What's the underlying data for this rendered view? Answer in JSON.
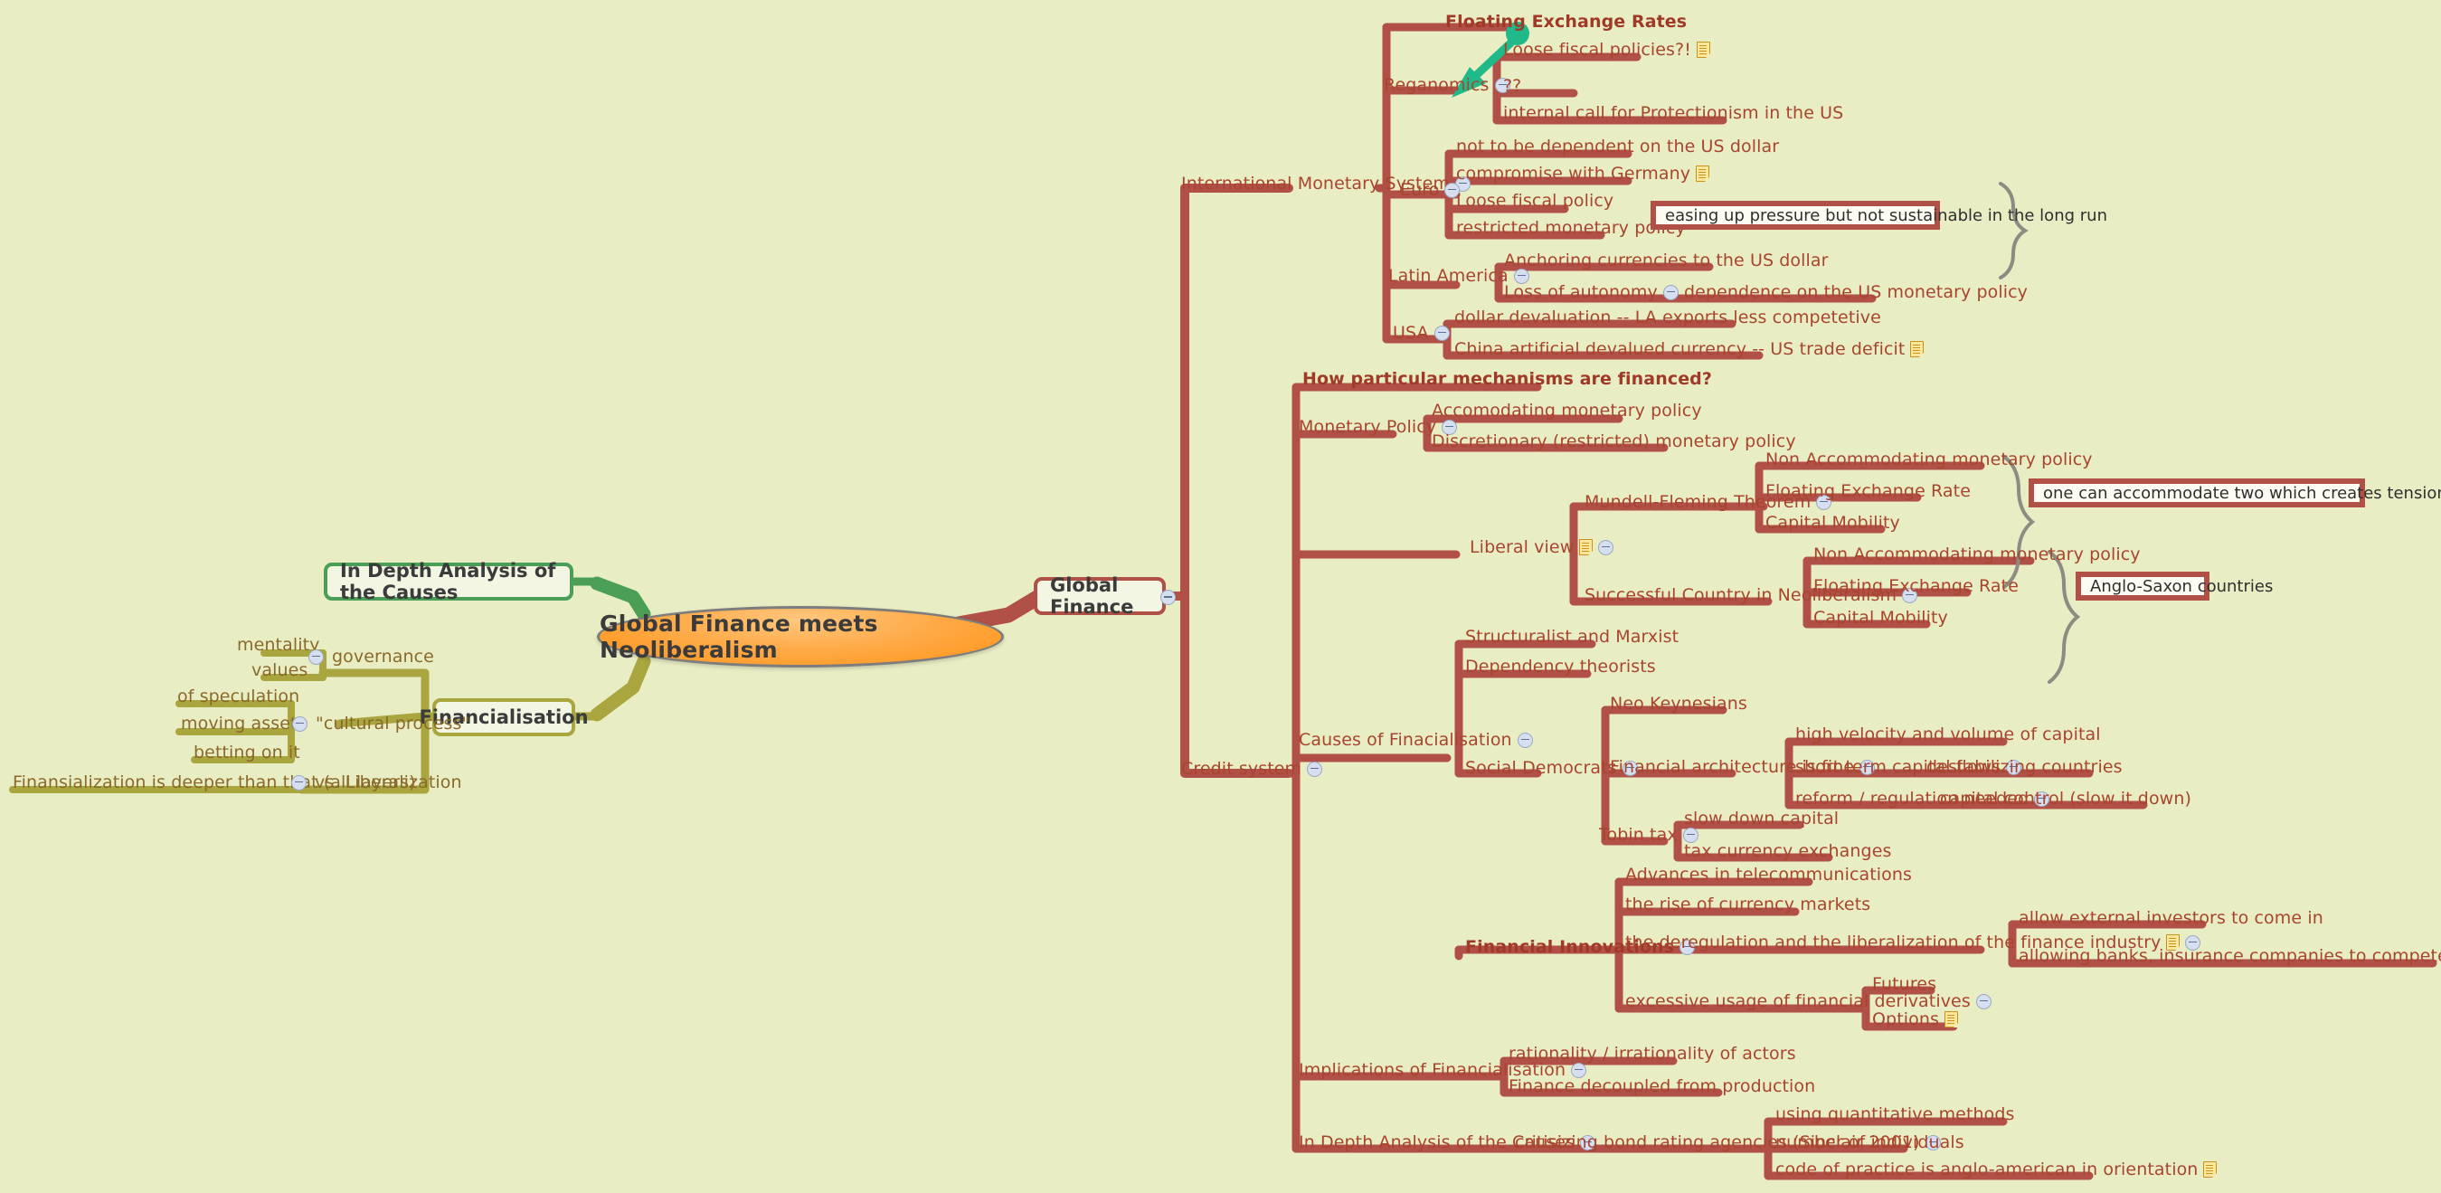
{
  "root": {
    "label": "Global Finance meets Neoliberalism"
  },
  "main_nodes": {
    "in_depth_left": "In Depth Analysis of the Causes",
    "financialisation": "Financialisation",
    "global_finance": "Global Finance"
  },
  "branches": {
    "international_monetary_system": {
      "label": "International Monetary System",
      "children": {
        "floating_exchange_rates": "Floating Exchange Rates",
        "reganomics": {
          "label": "Reganomics",
          "children": [
            "Loose fiscal policies?!",
            "??",
            "internal call for Protectionism in the US"
          ]
        },
        "euro": {
          "label": "Euro",
          "children": [
            "not to be dependent on the US dollar",
            "compromise with Germany",
            "Loose fiscal policy",
            "restricted monetary policy"
          ],
          "callout": "easing up pressure but not sustainable in the long run"
        },
        "latin_america": {
          "label": "Latin America",
          "children": [
            "Anchoring currencies to the US dollar",
            "Loss of autonomy"
          ],
          "grandchild": "dependence on the US monetary policy"
        },
        "usa": {
          "label": "USA",
          "children": [
            "dollar devaluation -- LA exports less competetive",
            "China artificial devalued currency -- US trade deficit"
          ]
        }
      }
    },
    "credit_system": {
      "label": "Credit system",
      "children": {
        "how_financed": "How particular mechanisms are financed?",
        "monetary_policy": {
          "label": "Monetary Policy",
          "children": [
            "Accomodating monetary policy",
            "Discretionary (restricted) monetary policy"
          ]
        },
        "liberal_view": {
          "label": "Liberal view",
          "mundell": {
            "label": "Mundell-Fleming Theorem",
            "children": [
              "Non Accommodating monetary policy",
              "Floating Exchange Rate",
              "Capital Mobility"
            ],
            "callout": "one can accommodate two which creates tension with the third"
          },
          "successful": {
            "label": "Successful Country in Neoliberalism",
            "children": [
              "Non Accommodating monetary policy",
              "Floating Exchange Rate",
              "Capital Mobility"
            ],
            "callout": "Anglo-Saxon countries"
          }
        },
        "causes": {
          "label": "Causes of Finacialisation",
          "children": [
            "Structuralist and Marxist",
            "Dependency theorists"
          ],
          "social_democrats": {
            "label": "Social Democrats",
            "children": {
              "neo_keynesians": "Neo Keynesians",
              "fin_architecture": {
                "label": "Financial architecture is fine",
                "children": [
                  "high velocity and volume of capital",
                  "short term capital flows",
                  "reform / regulation needed"
                ],
                "leaf_flows": "destabilizing countries",
                "leaf_reform": "capital control (slow it down)"
              },
              "tobin_tax": {
                "label": "Tobin tax",
                "children": [
                  "slow down capital",
                  "tax currency exchanges"
                ]
              }
            }
          },
          "financial_innovations": {
            "label": "Financial Innovations",
            "children": [
              "Advances in telecommunications",
              "the rise of currency markets",
              "the deregulation and the liberalization of the finance industry",
              "excessive usage of financial derivatives"
            ],
            "deregulation_children": [
              "allow external investors to come in",
              "allowing banks, insurance companies to compete in each other's sector"
            ],
            "derivatives_children": [
              "Futures",
              "Options"
            ]
          }
        },
        "implications": {
          "label": "Implications of Financialisation",
          "children": [
            "rationality / irrationality of actors",
            "Finance decoupled from production"
          ]
        },
        "in_depth": {
          "label": "In Depth Analysis of the Causes",
          "child": "critisizing bond rating agencies (Sinclair 2001)",
          "grandchildren": [
            "using quantitative methods",
            "number of individuals",
            "code of practice is anglo-american in orientation"
          ]
        }
      }
    },
    "financialisation": {
      "label": "Financialisation",
      "governance": {
        "label": "governance",
        "children": [
          "mentality",
          "values"
        ]
      },
      "cultural_process": {
        "label": "\"cultural process\"",
        "children": [
          "of speculation",
          "moving assets",
          "betting on it"
        ]
      },
      "vs_liberalization": {
        "label": "vs. Liberalization",
        "child": "Finansialization is deeper than that (all layers)"
      }
    }
  },
  "colors": {
    "background": "#e9edc4",
    "red_branch": "#b05046",
    "olive_branch": "#a9a63f",
    "green_branch": "#4a9e55",
    "root_orange": "#ff9416",
    "text_red": "#a8452f",
    "text_olive": "#8a6a2a",
    "arrow_green": "#1fb98a"
  },
  "icons": {
    "collapse": "minus-circle-icon",
    "note": "note-icon",
    "arrow": "green-arrow-icon"
  }
}
